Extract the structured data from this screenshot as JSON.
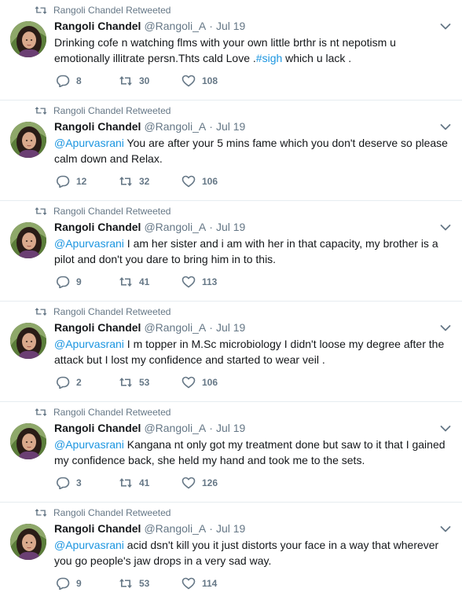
{
  "tweets": [
    {
      "retweeted_by": "Rangoli Chandel Retweeted",
      "name": "Rangoli Chandel",
      "handle": "@Rangoli_A",
      "separator": "·",
      "date": "Jul 19",
      "mention": "",
      "body": "Drinking cofe n watching flms with your own little brthr is nt nepotism u emotionally illitrate persn.Thts cald Love .",
      "hashtag": "#sigh",
      "body_tail": " which u lack .",
      "replies": "8",
      "retweets": "30",
      "likes": "108"
    },
    {
      "retweeted_by": "Rangoli Chandel Retweeted",
      "name": "Rangoli Chandel",
      "handle": "@Rangoli_A",
      "separator": "·",
      "date": "Jul 19",
      "mention": "@Apurvasrani",
      "body": " You are after your 5 mins fame which you don't deserve so please calm down and Relax.",
      "hashtag": "",
      "body_tail": "",
      "replies": "12",
      "retweets": "32",
      "likes": "106"
    },
    {
      "retweeted_by": "Rangoli Chandel Retweeted",
      "name": "Rangoli Chandel",
      "handle": "@Rangoli_A",
      "separator": "·",
      "date": "Jul 19",
      "mention": "@Apurvasrani",
      "body": " I am her sister and i am with her in that capacity, my brother is a pilot and don't you dare to bring him in to this.",
      "hashtag": "",
      "body_tail": "",
      "replies": "9",
      "retweets": "41",
      "likes": "113"
    },
    {
      "retweeted_by": "Rangoli Chandel Retweeted",
      "name": "Rangoli Chandel",
      "handle": "@Rangoli_A",
      "separator": "·",
      "date": "Jul 19",
      "mention": "@Apurvasrani",
      "body": " I m topper in M.Sc microbiology I didn't loose my degree after the attack but I lost my confidence and started to wear veil .",
      "hashtag": "",
      "body_tail": "",
      "replies": "2",
      "retweets": "53",
      "likes": "106"
    },
    {
      "retweeted_by": "Rangoli Chandel Retweeted",
      "name": "Rangoli Chandel",
      "handle": "@Rangoli_A",
      "separator": "·",
      "date": "Jul 19",
      "mention": "@Apurvasrani",
      "body": " Kangana nt only got my treatment done but saw to it that I gained my confidence back, she held my hand and took me to the sets.",
      "hashtag": "",
      "body_tail": "",
      "replies": "3",
      "retweets": "41",
      "likes": "126"
    },
    {
      "retweeted_by": "Rangoli Chandel Retweeted",
      "name": "Rangoli Chandel",
      "handle": "@Rangoli_A",
      "separator": "·",
      "date": "Jul 19",
      "mention": "@Apurvasrani",
      "body": " acid dsn't kill you it just distorts your face in a way that wherever you go people's jaw drops in a very sad way.",
      "hashtag": "",
      "body_tail": "",
      "replies": "9",
      "retweets": "53",
      "likes": "114"
    }
  ],
  "icons": {
    "retweeted": "retweet-icon",
    "avatar": "avatar",
    "caret": "chevron-down-icon",
    "reply": "reply-icon",
    "retweet": "retweet-icon",
    "like": "heart-icon"
  },
  "colors": {
    "link": "#1b95e0",
    "muted": "#657786",
    "text": "#14171a",
    "divider": "#e6ecf0"
  }
}
